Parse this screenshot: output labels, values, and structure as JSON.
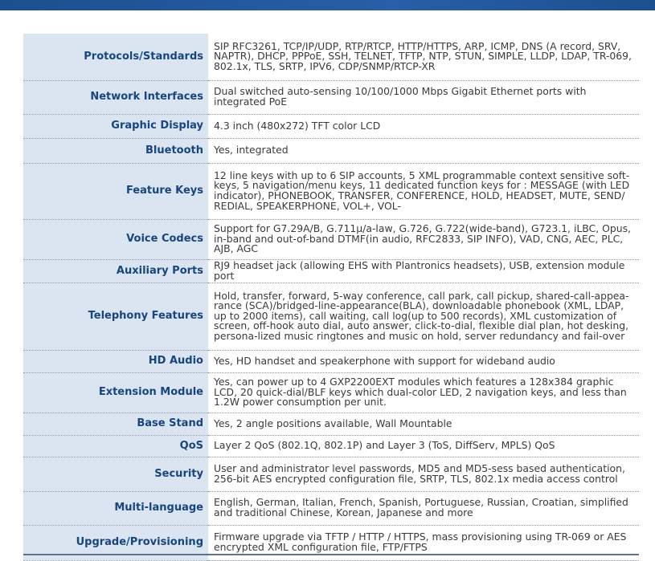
{
  "spec_rows": [
    {
      "label": "Protocols/Standards",
      "value": "SIP RFC3261, TCP/IP/UDP, RTP/RTCP, HTTP/HTTPS, ARP, ICMP, DNS (A record, SRV, NAPTR), DHCP, PPPoE, SSH, TELNET, TFTP, NTP, STUN, SIMPLE, LLDP, LDAP, TR-069, 802.1x, TLS, SRTP, IPV6, CDP/SNMP/RTCP-XR"
    },
    {
      "label": "Network Interfaces",
      "value": "Dual switched auto-sensing 10/100/1000 Mbps Gigabit Ethernet ports with integrated PoE"
    },
    {
      "label": "Graphic Display",
      "value": "4.3 inch (480x272) TFT color LCD"
    },
    {
      "label": "Bluetooth",
      "value": "Yes, integrated"
    },
    {
      "label": "Feature Keys",
      "value": "12 line keys with up to 6 SIP accounts, 5 XML programmable context sensitive soft-keys, 5 navigation/menu keys, 11 dedicated function keys for : MESSAGE (with LED indicator), PHONEBOOK, TRANSFER, CONFERENCE, HOLD, HEADSET, MUTE, SEND/ REDIAL, SPEAKERPHONE, VOL+, VOL-"
    },
    {
      "label": "Voice Codecs",
      "value": "Support for G7.29A/B, G.711µ/a-law, G.726, G.722(wide-band), G723.1, iLBC, Opus, in-band and out-of-band DTMF(in audio, RFC2833, SIP INFO), VAD, CNG, AEC, PLC, AJB, AGC"
    },
    {
      "label": "Auxiliary Ports",
      "value": "RJ9 headset jack (allowing EHS with Plantronics headsets), USB, extension module port"
    },
    {
      "label": "Telephony Features",
      "value": "Hold, transfer, forward, 5-way conference, call park, call pickup, shared-call-appea-rance (SCA)/bridged-line-appearance(BLA), downloadable phonebook (XML, LDAP, up to 2000 items), call waiting, call log(up to 500 records), XML customization of screen, off-hook auto dial, auto answer, click-to-dial, flexible dial plan, hot desking, persona-lized music ringtones and music on hold, server redundancy and fail-over"
    },
    {
      "label": "HD Audio",
      "value": "Yes, HD handset and speakerphone with support for wideband audio"
    },
    {
      "label": "Extension Module",
      "value": "Yes, can power up to 4 GXP2200EXT modules which features a 128x384 graphic LCD, 20 quick-dial/BLF keys which dual-color LED, 2 navigation keys, and less than 1.2W power consumption per unit."
    },
    {
      "label": "Base Stand",
      "value": "Yes, 2 angle positions available, Wall Mountable"
    },
    {
      "label": "QoS",
      "value": "Layer 2 QoS (802.1Q, 802.1P) and Layer 3 (ToS, DiffServ, MPLS) QoS"
    },
    {
      "label": "Security",
      "value": "User and administrator level passwords, MD5 and MD5-sess based authentication, 256-bit AES encrypted configuration file, SRTP, TLS, 802.1x media access control"
    },
    {
      "label": "Multi-language",
      "value": "English, German, Italian, French, Spanish, Portuguese, Russian, Croatian, simplified and traditional Chinese, Korean, Japanese and more"
    },
    {
      "label": "Upgrade/Provisioning",
      "value": "Firmware upgrade via TFTP / HTTP / HTTPS, mass provisioning using TR-069 or AES encrypted XML configuration file, FTP/FTPS"
    }
  ]
}
